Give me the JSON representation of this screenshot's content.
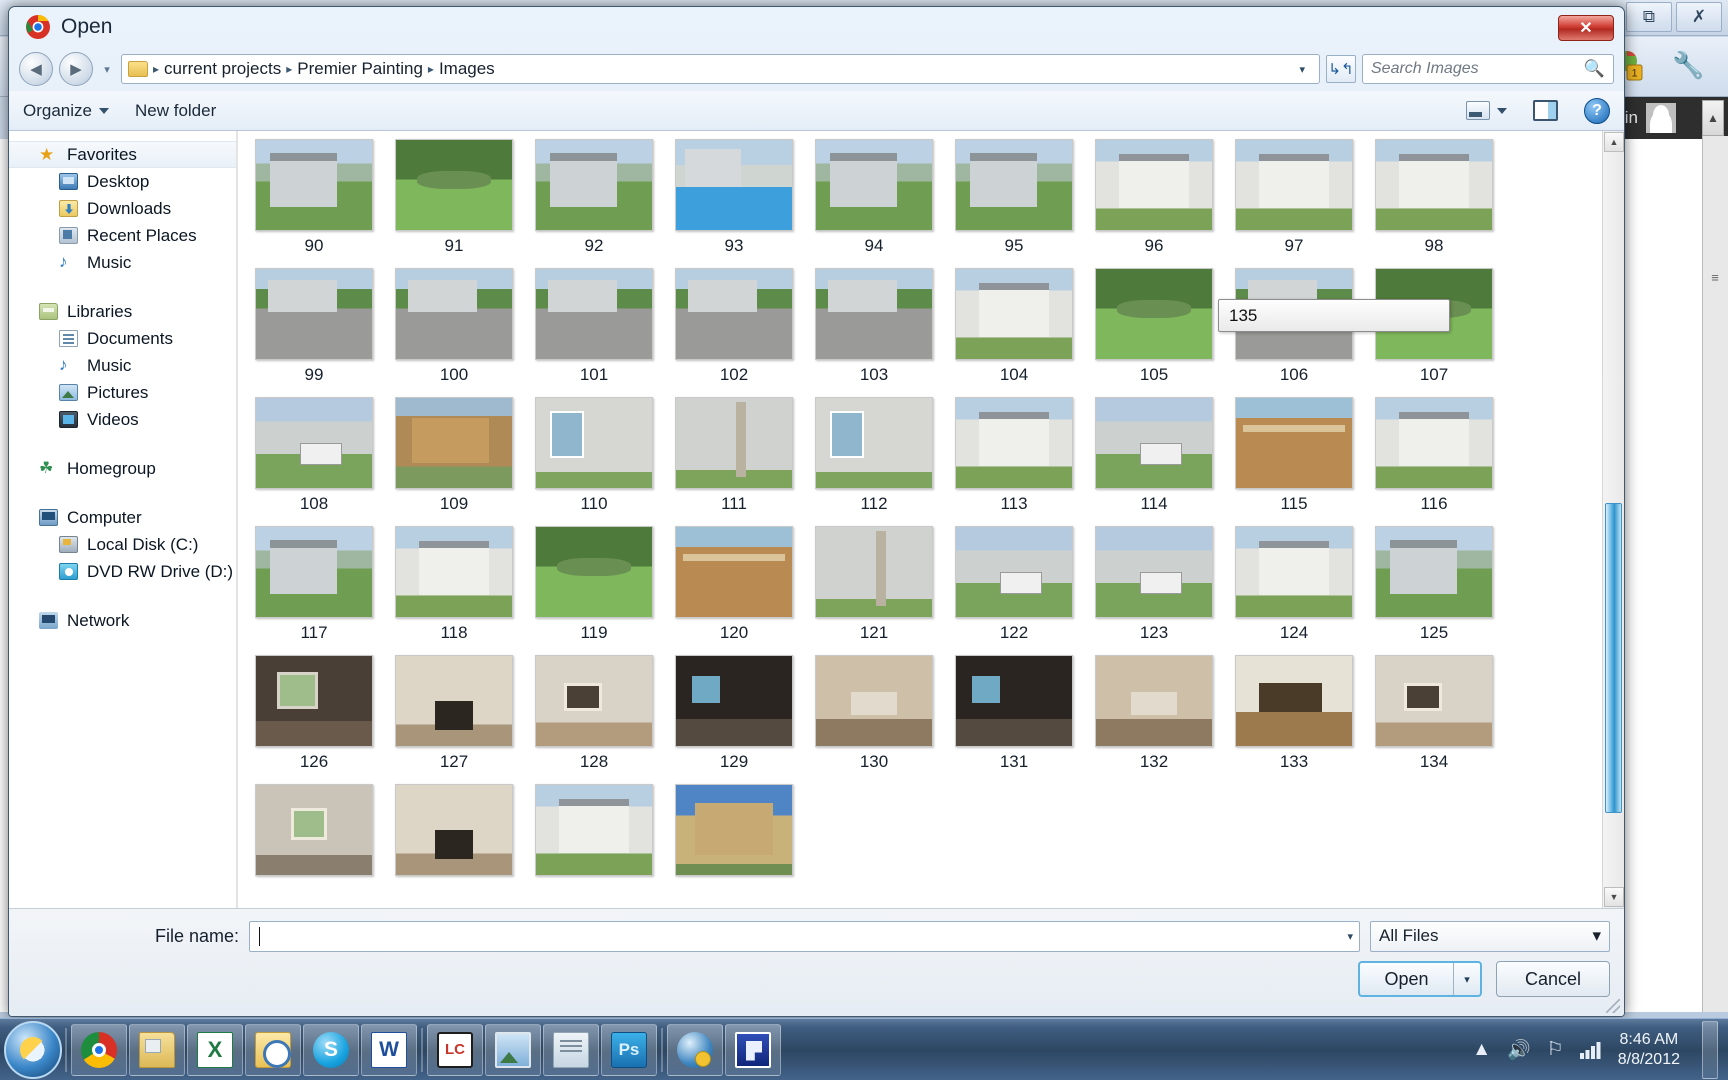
{
  "background_app": {
    "restore_icon": "restore-icon",
    "close_icon": "close-icon",
    "account_name": "min",
    "scroll_up_icon": "chevron-up-icon",
    "rail_mark": "≡"
  },
  "dialog": {
    "title": "Open",
    "app_icon": "chrome-icon",
    "close_label": "✕",
    "nav": {
      "back_icon": "back-arrow-icon",
      "forward_icon": "forward-arrow-icon",
      "history_caret": "▾",
      "breadcrumb_caret": "▾",
      "refresh_icon": "refresh-icon",
      "folder_icon": "folder-icon",
      "crumbs": [
        "current projects",
        "Premier Painting",
        "Images"
      ],
      "separator": "▸"
    },
    "search": {
      "placeholder": "Search Images",
      "icon": "search-icon"
    },
    "commandbar": {
      "organize_label": "Organize",
      "new_folder_label": "New folder",
      "view_icon": "view-layout-icon",
      "view_caret": "▾",
      "preview_pane_icon": "preview-pane-icon",
      "help_icon": "help-icon",
      "help_glyph": "?"
    },
    "sidebar": {
      "groups": [
        {
          "header": {
            "label": "Favorites",
            "icon": "star-icon",
            "icon_class": "ni-star",
            "selected": true
          },
          "items": [
            {
              "label": "Desktop",
              "icon": "desktop-icon",
              "icon_class": "ni-desktop"
            },
            {
              "label": "Downloads",
              "icon": "downloads-icon",
              "icon_class": "ni-download"
            },
            {
              "label": "Recent Places",
              "icon": "recent-places-icon",
              "icon_class": "ni-recent"
            },
            {
              "label": "Music",
              "icon": "music-note-icon",
              "icon_class": "ni-music"
            }
          ]
        },
        {
          "header": {
            "label": "Libraries",
            "icon": "libraries-icon",
            "icon_class": "ni-libraries",
            "selected": false
          },
          "items": [
            {
              "label": "Documents",
              "icon": "document-icon",
              "icon_class": "ni-documents"
            },
            {
              "label": "Music",
              "icon": "music-note-icon",
              "icon_class": "ni-music"
            },
            {
              "label": "Pictures",
              "icon": "pictures-icon",
              "icon_class": "ni-pictures"
            },
            {
              "label": "Videos",
              "icon": "videos-icon",
              "icon_class": "ni-videos"
            }
          ]
        },
        {
          "header": {
            "label": "Homegroup",
            "icon": "homegroup-icon",
            "icon_class": "ni-homegroup",
            "selected": false
          },
          "items": []
        },
        {
          "header": {
            "label": "Computer",
            "icon": "computer-icon",
            "icon_class": "ni-computer",
            "selected": false
          },
          "items": [
            {
              "label": "Local Disk (C:)",
              "icon": "hard-disk-icon",
              "icon_class": "ni-disk"
            },
            {
              "label": "DVD RW Drive (D:) R",
              "icon": "dvd-drive-icon",
              "icon_class": "ni-dvd"
            }
          ]
        },
        {
          "header": {
            "label": "Network",
            "icon": "network-icon",
            "icon_class": "ni-network",
            "selected": false
          },
          "items": []
        }
      ]
    },
    "file_list": {
      "thumbnails": [
        {
          "label": "90",
          "scene": "sc-house-lawn"
        },
        {
          "label": "91",
          "scene": "sc-garden"
        },
        {
          "label": "92",
          "scene": "sc-house-lawn"
        },
        {
          "label": "93",
          "scene": "sc-pool"
        },
        {
          "label": "94",
          "scene": "sc-house-lawn"
        },
        {
          "label": "95",
          "scene": "sc-house-lawn"
        },
        {
          "label": "96",
          "scene": "sc-colonial"
        },
        {
          "label": "97",
          "scene": "sc-colonial"
        },
        {
          "label": "98",
          "scene": "sc-colonial"
        },
        {
          "label": "99",
          "scene": "sc-drive"
        },
        {
          "label": "100",
          "scene": "sc-drive"
        },
        {
          "label": "101",
          "scene": "sc-drive"
        },
        {
          "label": "102",
          "scene": "sc-drive"
        },
        {
          "label": "103",
          "scene": "sc-drive"
        },
        {
          "label": "104",
          "scene": "sc-colonial"
        },
        {
          "label": "105",
          "scene": "sc-garden"
        },
        {
          "label": "106",
          "scene": "sc-drive"
        },
        {
          "label": "107",
          "scene": "sc-garden"
        },
        {
          "label": "108",
          "scene": "sc-truck"
        },
        {
          "label": "109",
          "scene": "sc-constr"
        },
        {
          "label": "110",
          "scene": "sc-wall"
        },
        {
          "label": "111",
          "scene": "sc-ladder"
        },
        {
          "label": "112",
          "scene": "sc-wall"
        },
        {
          "label": "113",
          "scene": "sc-colonial"
        },
        {
          "label": "114",
          "scene": "sc-truck"
        },
        {
          "label": "115",
          "scene": "sc-deck"
        },
        {
          "label": "116",
          "scene": "sc-colonial"
        },
        {
          "label": "117",
          "scene": "sc-house-lawn"
        },
        {
          "label": "118",
          "scene": "sc-colonial"
        },
        {
          "label": "119",
          "scene": "sc-garden"
        },
        {
          "label": "120",
          "scene": "sc-deck"
        },
        {
          "label": "121",
          "scene": "sc-ladder"
        },
        {
          "label": "122",
          "scene": "sc-truck"
        },
        {
          "label": "123",
          "scene": "sc-truck"
        },
        {
          "label": "124",
          "scene": "sc-colonial"
        },
        {
          "label": "125",
          "scene": "sc-house-lawn"
        },
        {
          "label": "126",
          "scene": "sc-room-dark"
        },
        {
          "label": "127",
          "scene": "sc-fire"
        },
        {
          "label": "128",
          "scene": "sc-room-light"
        },
        {
          "label": "129",
          "scene": "sc-kitchen"
        },
        {
          "label": "130",
          "scene": "sc-living"
        },
        {
          "label": "131",
          "scene": "sc-kitchen"
        },
        {
          "label": "132",
          "scene": "sc-living"
        },
        {
          "label": "133",
          "scene": "sc-dining"
        },
        {
          "label": "134",
          "scene": "sc-room-light"
        },
        {
          "label": "",
          "scene": "sc-attic"
        },
        {
          "label": "",
          "scene": "sc-fire"
        },
        {
          "label": "",
          "scene": "sc-colonial"
        },
        {
          "label": "",
          "scene": "sc-victorian"
        }
      ],
      "scroll_tooltip": "135",
      "scrollbar": {
        "up_arrow": "▲",
        "down_arrow": "▼"
      }
    },
    "bottom": {
      "filename_label": "File name:",
      "filename_value": "",
      "filename_caret": "▾",
      "filetype_value": "All Files",
      "filetype_caret": "▾",
      "open_label": "Open",
      "open_split_caret": "▾",
      "cancel_label": "Cancel"
    }
  },
  "taskbar": {
    "start_icon": "windows-start-icon",
    "items": [
      {
        "name": "chrome-taskbar-icon",
        "class": "ic-chrome"
      },
      {
        "name": "explorer-taskbar-icon",
        "class": "ic-explorer"
      },
      {
        "name": "excel-taskbar-icon",
        "class": "ic-excel"
      },
      {
        "name": "outlook-taskbar-icon",
        "class": "ic-outlook"
      },
      {
        "name": "skype-taskbar-icon",
        "class": "ic-skype"
      },
      {
        "name": "word-taskbar-icon",
        "class": "ic-word"
      },
      {
        "name": "lc-taskbar-icon",
        "class": "ic-lc"
      },
      {
        "name": "photo-viewer-taskbar-icon",
        "class": "ic-photo"
      },
      {
        "name": "notepad-taskbar-icon",
        "class": "ic-notepad"
      },
      {
        "name": "photoshop-taskbar-icon",
        "class": "ic-ps"
      },
      {
        "name": "globe-taskbar-icon",
        "class": "ic-globe"
      },
      {
        "name": "blue-app-taskbar-icon",
        "class": "ic-blue"
      }
    ],
    "tray": {
      "show_hidden_icon": "▲",
      "volume_icon": "🔊",
      "action_center_icon": "flag-icon",
      "network_icon": "signal-bars-icon",
      "time": "8:46 AM",
      "date": "8/8/2012"
    }
  }
}
